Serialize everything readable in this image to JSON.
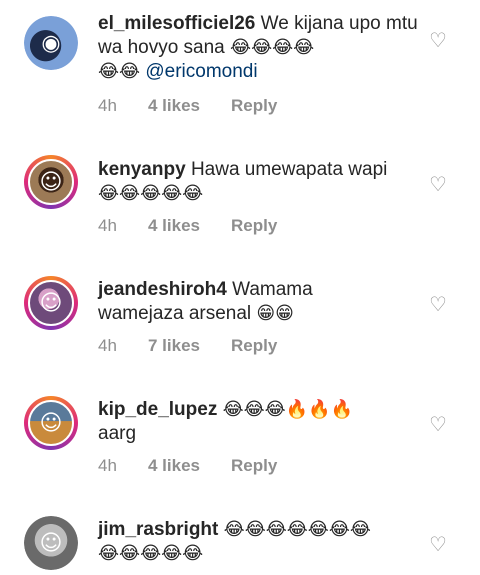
{
  "comments": [
    {
      "username": "el_milesofficiel26",
      "text": "We kijana upo mtu wa hovyo sana",
      "emoji": "😂😂😂😂",
      "emoji2": "😂😂",
      "mention": "@ericomondi",
      "time": "4h",
      "likes": "4 likes",
      "reply": "Reply",
      "avatar": "person-pair-avatar",
      "icons": [
        "heart-outline-icon"
      ]
    },
    {
      "username": "kenyanpy",
      "text": "Hawa umewapata wapi",
      "emoji": "😂😂😂😂😂",
      "time": "4h",
      "likes": "4 likes",
      "reply": "Reply",
      "avatar": "person-avatar"
    },
    {
      "username": "jeandeshiroh4",
      "text": "Wamama",
      "text2": "wamejaza arsenal",
      "emoji": "😁😁",
      "time": "4h",
      "likes": "7 likes",
      "reply": "Reply",
      "avatar": "person-avatar"
    },
    {
      "username": "kip_de_lupez",
      "emoji": "😂😂😂🔥🔥🔥",
      "text": "aarg",
      "time": "4h",
      "likes": "4 likes",
      "reply": "Reply",
      "avatar": "person-avatar"
    },
    {
      "username": "jim_rasbright",
      "emoji": "😂😂😂😂😂😂😂",
      "emoji2": "😂😂😂😂😂",
      "avatar": "person-avatar"
    }
  ],
  "colors": {
    "text": "#262626",
    "muted": "#8e8e8e",
    "mention": "#00376b",
    "ring_start": "#f58529",
    "ring_end": "#8134af"
  }
}
